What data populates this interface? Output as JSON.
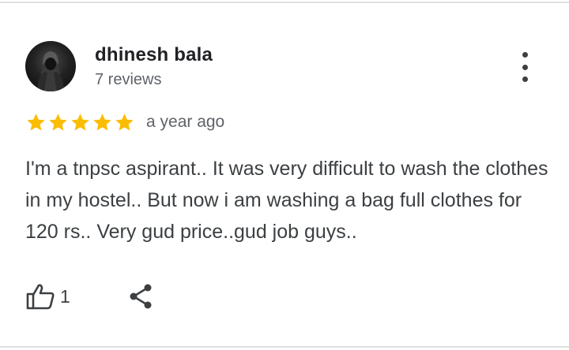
{
  "review": {
    "author": "dhinesh bala",
    "author_reviews": "7 reviews",
    "rating": 5,
    "rating_max": 5,
    "date": "a year ago",
    "text": "I'm a tnpsc aspirant.. It was very difficult to wash the clothes in my hostel.. But now i am washing a bag full clothes for 120 rs.. Very gud price..gud job guys..",
    "like_count": "1"
  },
  "colors": {
    "star": "#fbbc04",
    "text_primary": "#202124",
    "text_secondary": "#5f6368",
    "icon": "#3c4043"
  },
  "icons": {
    "more": "more-vert-icon",
    "like": "thumb-up-icon",
    "share": "share-icon",
    "star": "star-icon"
  }
}
